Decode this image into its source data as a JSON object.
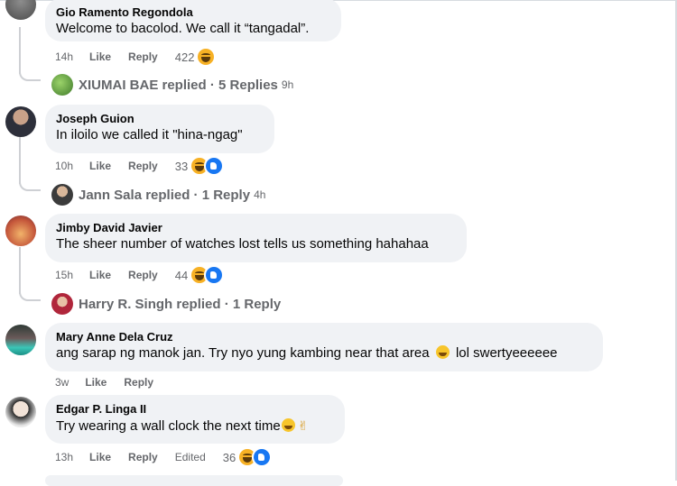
{
  "comments": [
    {
      "author": "Gio Ramento Regondola",
      "text": "Welcome to bacolod. We call it “tangadal”.",
      "time": "14h",
      "like_label": "Like",
      "reply_label": "Reply",
      "reaction_count": "422",
      "reactions": [
        "haha-icon"
      ],
      "replied": {
        "name": "XIUMAI BAE replied · 5 Replies",
        "ago": "9h"
      }
    },
    {
      "author": "Joseph Guion",
      "text": "In iloilo we called it \"hina-ngag\"",
      "time": "10h",
      "like_label": "Like",
      "reply_label": "Reply",
      "reaction_count": "33",
      "reactions": [
        "haha-icon",
        "like-icon"
      ],
      "replied": {
        "name": "Jann Sala replied · 1 Reply",
        "ago": "4h"
      }
    },
    {
      "author": "Jimby David Javier",
      "text": "The sheer number of watches lost tells us something hahahaa",
      "time": "15h",
      "like_label": "Like",
      "reply_label": "Reply",
      "reaction_count": "44",
      "reactions": [
        "haha-icon",
        "like-icon"
      ],
      "replied": {
        "name": "Harry R. Singh replied · 1 Reply",
        "ago": ""
      }
    },
    {
      "author": "Mary Anne Dela Cruz",
      "text_before": "ang sarap ng manok jan. Try nyo yung kambing near that area",
      "text_after": "lol swertyeeeeee",
      "time": "3w",
      "like_label": "Like",
      "reply_label": "Reply"
    },
    {
      "author": "Edgar P. Linga II",
      "text": "Try wearing a wall clock the next time",
      "time": "13h",
      "like_label": "Like",
      "reply_label": "Reply",
      "edited_label": "Edited",
      "reaction_count": "36",
      "reactions": [
        "haha-icon",
        "like-icon"
      ]
    }
  ],
  "colors": {
    "bubble": "#f0f2f5",
    "meta_text": "#65676b",
    "like_blue": "#1877f2",
    "haha_yellow": "#f7b125"
  }
}
